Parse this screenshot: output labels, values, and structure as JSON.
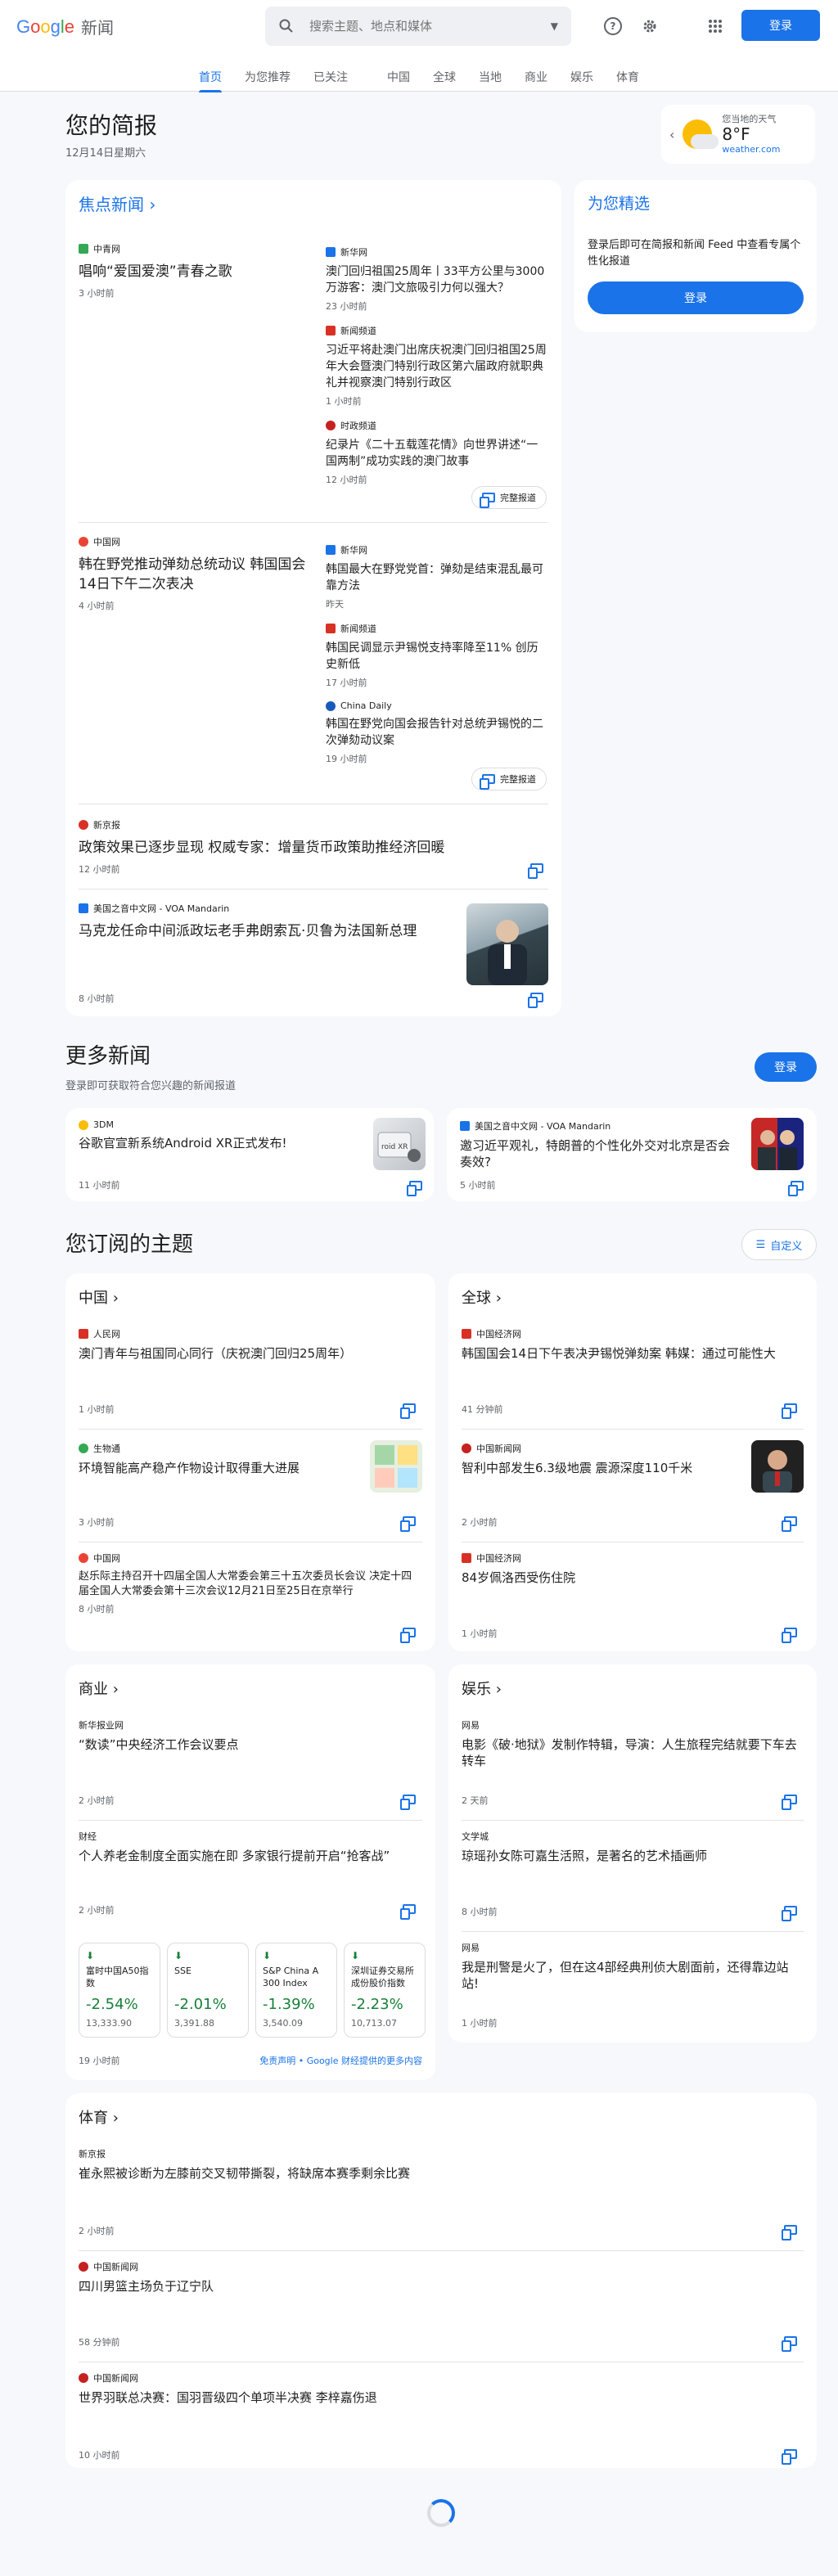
{
  "header": {
    "logo_google": "Google",
    "logo_news": "新闻",
    "search_placeholder": "搜索主题、地点和媒体",
    "signin": "登录",
    "tabs": [
      "首页",
      "为您推荐",
      "已关注",
      "中国",
      "全球",
      "当地",
      "商业",
      "娱乐",
      "体育"
    ]
  },
  "brief": {
    "title": "您的简报",
    "date": "12月14日星期六"
  },
  "weather": {
    "location": "您当地的天气",
    "temp": "8°F",
    "source": "weather.com"
  },
  "top": {
    "title": "焦点新闻",
    "clusters": [
      {
        "main": {
          "source": "中青网",
          "title": "唱响“爱国爱澳”青春之歌",
          "time": "3 小时前"
        },
        "side": [
          {
            "source": "新华网",
            "title": "澳门回归祖国25周年丨33平方公里与3000万游客：澳门文旅吸引力何以强大？",
            "time": "23 小时前"
          },
          {
            "source": "新闻频道",
            "title": "习近平将赴澳门出席庆祝澳门回归祖国25周年大会暨澳门特别行政区第六届政府就职典礼并视察澳门特别行政区",
            "time": "1 小时前"
          },
          {
            "source": "时政频道",
            "title": "纪录片《二十五载莲花情》向世界讲述“一国两制”成功实践的澳门故事",
            "time": "12 小时前"
          }
        ],
        "full": "完整报道"
      },
      {
        "main": {
          "source": "中国网",
          "title": "韩在野党推动弹劾总统动议 韩国国会14日下午二次表决",
          "time": "4 小时前"
        },
        "side": [
          {
            "source": "新华网",
            "title": "韩国最大在野党党首：弹劾是结束混乱最可靠方法",
            "time": "昨天"
          },
          {
            "source": "新闻频道",
            "title": "韩国民调显示尹锡悦支持率降至11% 创历史新低",
            "time": "17 小时前"
          },
          {
            "source": "China Daily",
            "title": "韩国在野党向国会报告针对总统尹锡悦的二次弹劾动议案",
            "time": "19 小时前"
          }
        ],
        "full": "完整报道"
      }
    ],
    "single1": {
      "source": "新京报",
      "title": "政策效果已逐步显现 权威专家：增量货币政策助推经济回暖",
      "time": "12 小时前"
    },
    "single2": {
      "source": "美国之音中文网 - VOA Mandarin",
      "title": "马克龙任命中间派政坛老手弗朗索瓦·贝鲁为法国新总理",
      "time": "8 小时前"
    }
  },
  "picks": {
    "title": "为您精选",
    "text": "登录后即可在简报和新闻 Feed 中查看专属个性化报道",
    "signin": "登录"
  },
  "more": {
    "title": "更多新闻",
    "sub": "登录即可获取符合您兴趣的新闻报道",
    "signin": "登录",
    "items": [
      {
        "source": "3DM",
        "title": "谷歌官宣新系统Android XR正式发布!",
        "time": "11 小时前"
      },
      {
        "source": "美国之音中文网 - VOA Mandarin",
        "title": "邀习近平观礼，特朗普的个性化外交对北京是否会奏效?",
        "time": "5 小时前"
      }
    ]
  },
  "topics": {
    "title": "您订阅的主题",
    "customize": "自定义",
    "china": {
      "title": "中国",
      "items": [
        {
          "source": "人民网",
          "title": "澳门青年与祖国同心同行（庆祝澳门回归25周年）",
          "time": "1 小时前"
        },
        {
          "source": "生物通",
          "title": "环境智能高产稳产作物设计取得重大进展",
          "time": "3 小时前"
        },
        {
          "source": "中国网",
          "title": "赵乐际主持召开十四届全国人大常委会第三十五次委员长会议 决定十四届全国人大常委会第十三次会议12月21日至25日在京举行",
          "time": "8 小时前"
        }
      ]
    },
    "world": {
      "title": "全球",
      "items": [
        {
          "source": "中国经济网",
          "title": "韩国国会14日下午表决尹锡悦弹劾案 韩媒：通过可能性大",
          "time": "41 分钟前"
        },
        {
          "source": "中国新闻网",
          "title": "智利中部发生6.3级地震 震源深度110千米",
          "time": "2 小时前"
        },
        {
          "source": "中国经济网",
          "title": "84岁佩洛西受伤住院",
          "time": "1 小时前"
        }
      ]
    },
    "business": {
      "title": "商业",
      "items": [
        {
          "source": "新华报业网",
          "title": "“数读”中央经济工作会议要点",
          "time": "2 小时前"
        },
        {
          "source": "财经",
          "title": "个人养老金制度全面实施在即 多家银行提前开启“抢客战”",
          "time": "2 小时前"
        }
      ],
      "stocks": [
        {
          "name": "富时中国A50指数",
          "pct": "-2.54%",
          "val": "13,333.90"
        },
        {
          "name": "SSE",
          "pct": "-2.01%",
          "val": "3,391.88"
        },
        {
          "name": "S&P China A 300 Index (CNY)",
          "pct": "-1.39%",
          "val": "3,540.09"
        },
        {
          "name": "深圳证券交易所成份股价指数",
          "pct": "-2.23%",
          "val": "10,713.07"
        }
      ],
      "stock_time": "19 小时前",
      "stock_note": "免责声明 • Google 财经提供的更多内容"
    },
    "ent": {
      "title": "娱乐",
      "items": [
        {
          "source": "网易",
          "title": "电影《破·地狱》发制作特辑，导演：人生旅程完结就要下车去转车",
          "time": "2 天前"
        },
        {
          "source": "文学城",
          "title": "琼瑶孙女陈可嘉生活照，是著名的艺术插画师",
          "time": "8 小时前"
        },
        {
          "source": "网易",
          "title": "我是刑警是火了，但在这4部经典刑侦大剧面前，还得靠边站站!",
          "time": "1 小时前"
        }
      ]
    },
    "sports": {
      "title": "体育",
      "items": [
        {
          "source": "新京报",
          "title": "崔永熙被诊断为左膝前交叉韧带撕裂，将缺席本赛季剩余比赛",
          "time": "2 小时前"
        },
        {
          "source": "中国新闻网",
          "title": "四川男篮主场负于辽宁队",
          "time": "58 分钟前"
        },
        {
          "source": "中国新闻网",
          "title": "世界羽联总决赛：国羽晋级四个单项半决赛 李梓嘉伤退",
          "time": "10 小时前"
        }
      ]
    }
  }
}
